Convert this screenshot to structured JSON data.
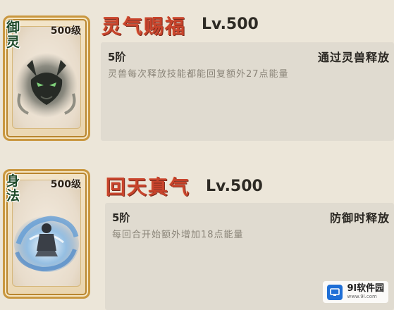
{
  "skills": [
    {
      "card_type": "御灵",
      "card_level": "500级",
      "card_art_icon": "spirit-beast-icon",
      "name": "灵气赐福",
      "level": "Lv.500",
      "stage": "5阶",
      "trigger": "通过灵兽释放",
      "effect": "灵兽每次释放技能都能回复额外27点能量"
    },
    {
      "card_type": "身法",
      "card_level": "500级",
      "card_art_icon": "whirlwind-figure-icon",
      "name": "回天真气",
      "level": "Lv.500",
      "stage": "5阶",
      "trigger": "防御时释放",
      "effect": "每回合开始额外增加18点能量"
    }
  ],
  "watermark": {
    "name": "9l软件园",
    "url": "www.9l.com"
  },
  "colors": {
    "title_red": "#c8442c",
    "card_border_gold": "#c9973f",
    "panel_bg": "#e0dbd0",
    "watermark_blue": "#1f6fd6"
  }
}
